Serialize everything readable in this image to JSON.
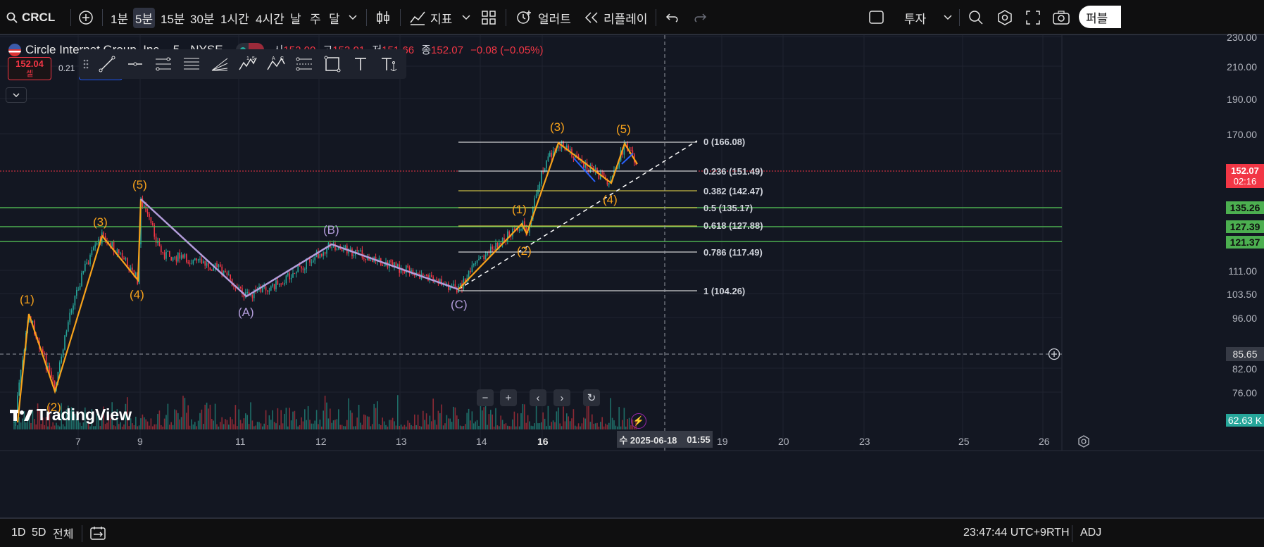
{
  "topbar": {
    "symbol": "CRCL",
    "timeframes": [
      "1분",
      "5분",
      "15분",
      "30분",
      "1시간",
      "4시간",
      "날",
      "주",
      "달"
    ],
    "active_timeframe": "5분",
    "indicators_label": "지표",
    "alert_label": "얼러트",
    "replay_label": "리플레이",
    "invest_label": "투자",
    "publish_label": "퍼블"
  },
  "legend": {
    "title": "Circle Internet Group, Inc. · 5 · NYSE",
    "open_label": "시",
    "open": "152.00",
    "high_label": "고",
    "high": "153.01",
    "low_label": "저",
    "low": "151.66",
    "close_label": "종",
    "close": "152.07",
    "change": "−0.08 (−0.05%)"
  },
  "trade": {
    "sell_price": "152.04",
    "sell_label": "셀",
    "spread": "0.21"
  },
  "price_axis": {
    "labels": [
      "230.00",
      "210.00",
      "190.00",
      "170.00",
      "111.00",
      "103.50",
      "96.00",
      "82.00",
      "76.00"
    ],
    "current_price": "152.07",
    "countdown": "02:16",
    "level_1": "135.26",
    "level_2": "127.39",
    "level_3": "121.37",
    "crosshair_price": "85.65",
    "volume": "62.63 K"
  },
  "time_axis": {
    "labels": [
      "7",
      "9",
      "11",
      "12",
      "13",
      "14",
      "16",
      "19",
      "20",
      "23",
      "25",
      "26"
    ],
    "crosshair_date": "수 2025-06-18",
    "crosshair_time": "01:55"
  },
  "fib_levels": [
    {
      "label": "0 (166.08)",
      "color": "#ffffff"
    },
    {
      "label": "0.236 (151.49)",
      "color": "#ffffff"
    },
    {
      "label": "0.382 (142.47)",
      "color": "#f2e14c"
    },
    {
      "label": "0.5 (135.17)",
      "color": "#f2e14c"
    },
    {
      "label": "0.618 (127.88)",
      "color": "#f2e14c"
    },
    {
      "label": "0.786 (117.49)",
      "color": "#ffffff"
    },
    {
      "label": "1 (104.26)",
      "color": "#ffffff"
    }
  ],
  "wave_labels": {
    "w1": "(1)",
    "w2": "(2)",
    "w3": "(3)",
    "w4": "(4)",
    "w5": "(5)",
    "wA": "(A)",
    "wB": "(B)",
    "wC": "(C)",
    "n1": "(1)",
    "n2": "(2)",
    "n3": "(3)",
    "n4": "(4)",
    "n5": "(5)"
  },
  "bottombar": {
    "ranges": [
      "1D",
      "5D",
      "전체"
    ],
    "clock": "23:47:44 UTC+9",
    "session": "RTH",
    "adj": "ADJ"
  },
  "branding": {
    "logo_text": "TradingView"
  },
  "colors": {
    "background": "#131722",
    "bull": "#26a69a",
    "bear": "#f23645",
    "impulse": "#f7a21b",
    "corrective": "#b39ddb",
    "level_green": "#4caf50"
  }
}
